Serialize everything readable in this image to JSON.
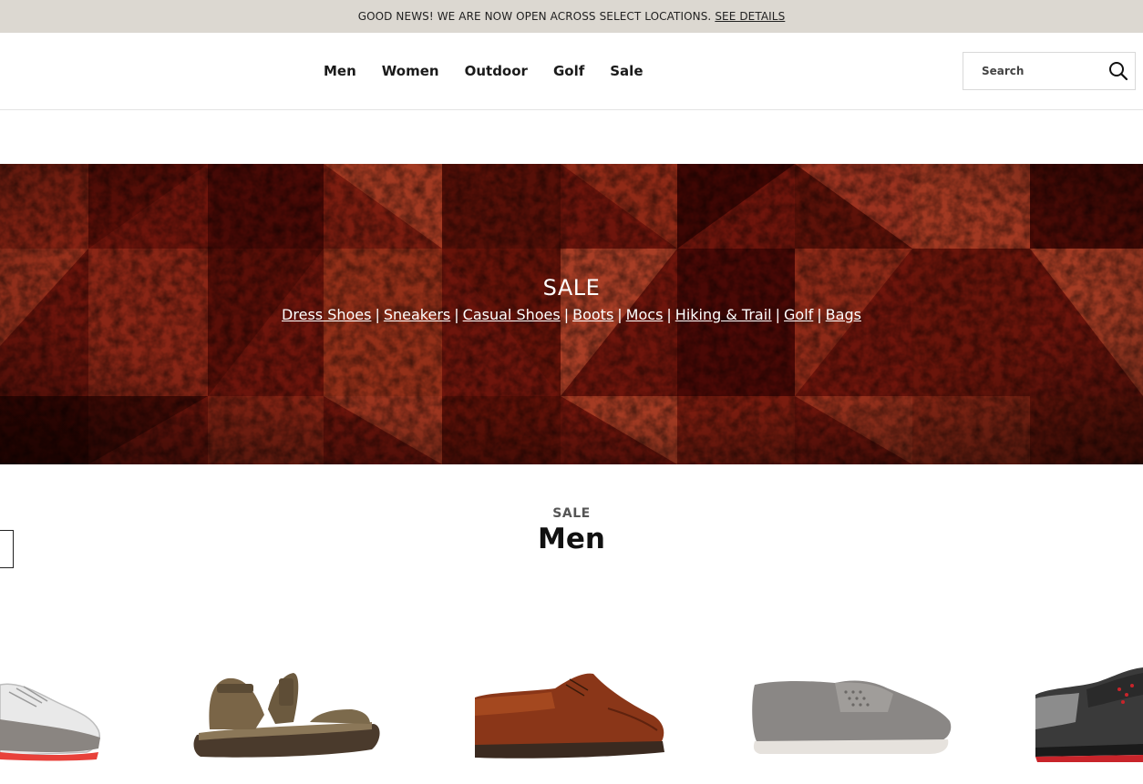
{
  "announcement": {
    "message": "GOOD NEWS! WE ARE NOW OPEN ACROSS SELECT LOCATIONS.",
    "link_label": "SEE DETAILS"
  },
  "nav": {
    "items": [
      {
        "label": "Men"
      },
      {
        "label": "Women"
      },
      {
        "label": "Outdoor"
      },
      {
        "label": "Golf"
      },
      {
        "label": "Sale"
      }
    ]
  },
  "search": {
    "placeholder": "Search",
    "icon": "search-icon"
  },
  "banner": {
    "title": "SALE",
    "links": [
      "Dress Shoes",
      "Sneakers",
      "Casual Shoes",
      "Boots",
      "Mocs",
      "Hiking & Trail",
      "Golf",
      "Bags"
    ],
    "separator": "|"
  },
  "section": {
    "eyebrow": "SALE",
    "title": "Men"
  },
  "products": [
    {
      "name": "golf-shoe-white"
    },
    {
      "name": "sandal-brown"
    },
    {
      "name": "dress-shoe-cognac"
    },
    {
      "name": "slip-on-grey"
    },
    {
      "name": "golf-shoe-black"
    }
  ],
  "colors": {
    "announcement_bg": "#dcd8d1",
    "banner_red": "#7a1a10",
    "text": "#111111"
  }
}
